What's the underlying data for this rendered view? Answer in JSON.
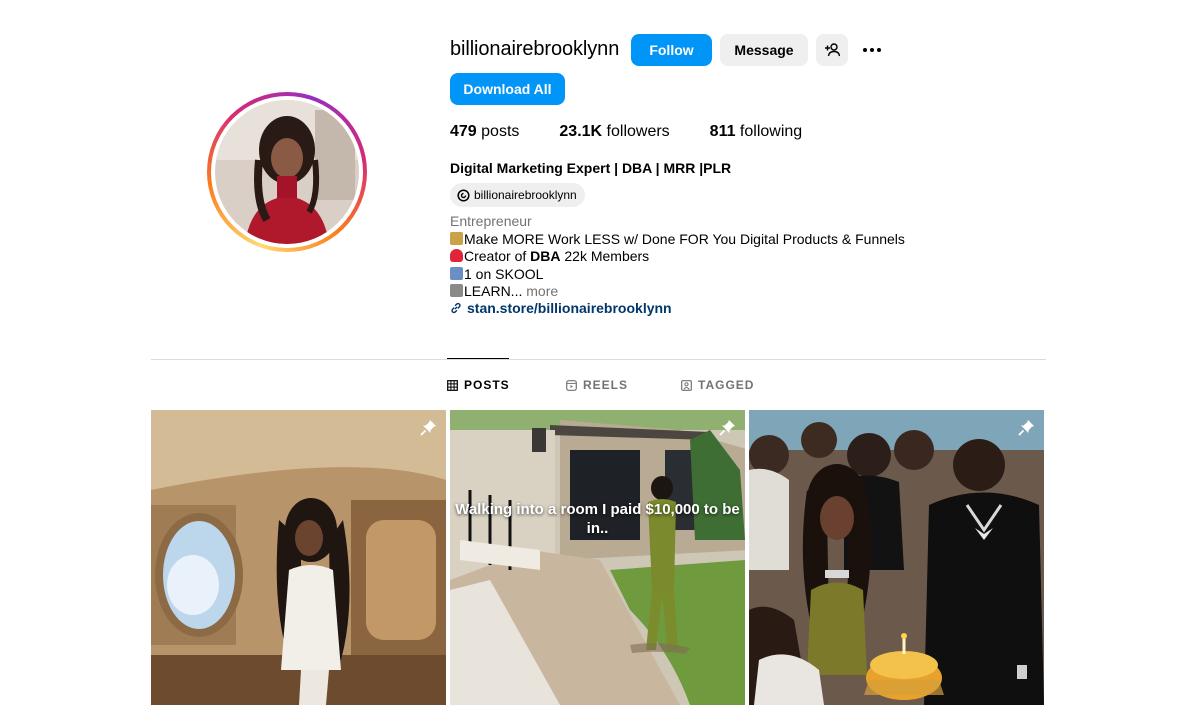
{
  "profile": {
    "username": "billionairebrooklynn",
    "follow_label": "Follow",
    "message_label": "Message",
    "download_label": "Download All"
  },
  "stats": [
    {
      "value": "479",
      "label": " posts"
    },
    {
      "value": "23.1K",
      "label": " followers"
    },
    {
      "value": "811",
      "label": " following"
    }
  ],
  "bio": {
    "name": "Digital Marketing Expert | DBA | MRR |PLR",
    "threads_handle": "billionairebrooklynn",
    "category": "Entrepreneur",
    "line1": "Make MORE Work LESS w/ Done FOR You Digital Products & Funnels",
    "line2_prefix": "Creator of ",
    "line2_bold": "DBA",
    "line2_suffix": " 22k Members",
    "line3": "1 on SKOOL",
    "line4": "LEARN...",
    "more": " more",
    "link": "stan.store/billionairebrooklynn"
  },
  "tabs": [
    {
      "label": "POSTS",
      "active": true
    },
    {
      "label": "REELS",
      "active": false
    },
    {
      "label": "TAGGED",
      "active": false
    }
  ],
  "posts": [
    {
      "overlay": "",
      "pinned": true
    },
    {
      "overlay": "Walking into a room I paid $10,000 to be in..",
      "pinned": true
    },
    {
      "overlay": "",
      "pinned": true
    }
  ],
  "colors": {
    "primary_blue": "#0095f6",
    "link_blue": "#00376b",
    "secondary_bg": "#efefef",
    "muted_text": "#737373"
  },
  "icons": {
    "add_user": "person-plus-icon",
    "more": "ellipsis-icon",
    "threads": "threads-icon",
    "link": "link-icon",
    "posts_tab": "grid-icon",
    "reels_tab": "reels-icon",
    "tagged_tab": "tagged-icon",
    "pinned": "pin-icon"
  }
}
